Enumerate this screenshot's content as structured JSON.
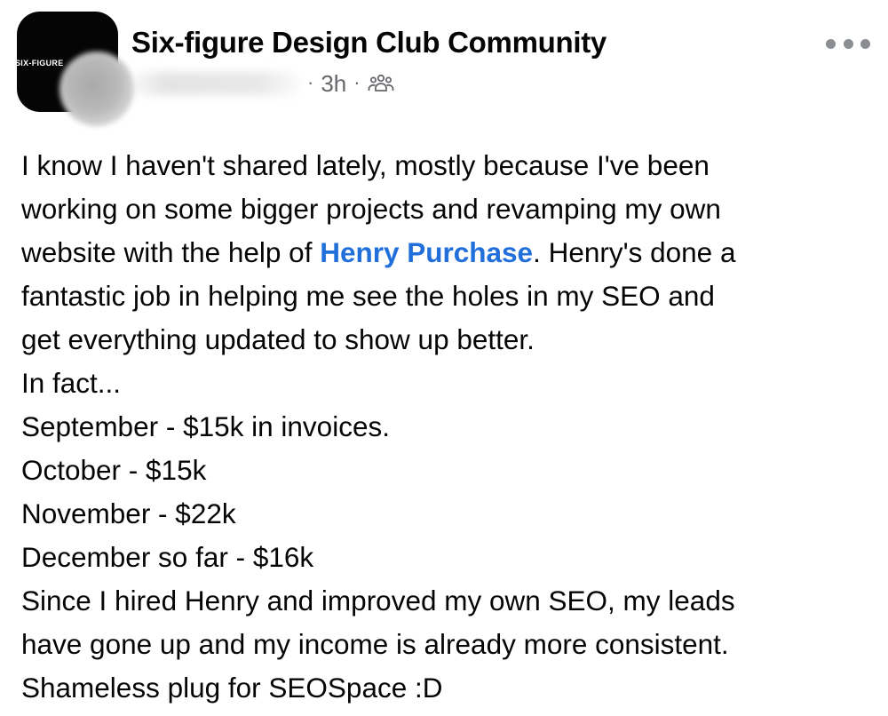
{
  "post": {
    "header": {
      "group_avatar_text": "SIX-FIGURE",
      "group_name": "Six-figure Design Club Community",
      "separator": "·",
      "time": "3h",
      "audience_icon": "group-members-icon",
      "more_icon": "more-options-icon"
    },
    "body": {
      "line_1": "I know I haven't shared lately, mostly because I've been",
      "line_2": "working on some bigger projects and revamping my own",
      "line_3_before": "website with the help of ",
      "mention": "Henry Purchase",
      "line_3_after": ". Henry's done a",
      "line_4": "fantastic job in helping me see the holes in my SEO and",
      "line_5": "get everything updated to show up better.",
      "line_6": "In fact...",
      "line_7": "September - $15k in invoices.",
      "line_8": "October - $15k",
      "line_9": "November - $22k",
      "line_10": "December so far - $16k",
      "line_11": "Since I hired Henry and improved my own SEO, my leads",
      "line_12": "have gone up and my income is already more consistent.",
      "line_13": "Shameless plug for SEOSpace :D"
    },
    "colors": {
      "mention": "#216fdb",
      "secondary_text": "#65676b",
      "primary_text": "#050505"
    }
  }
}
